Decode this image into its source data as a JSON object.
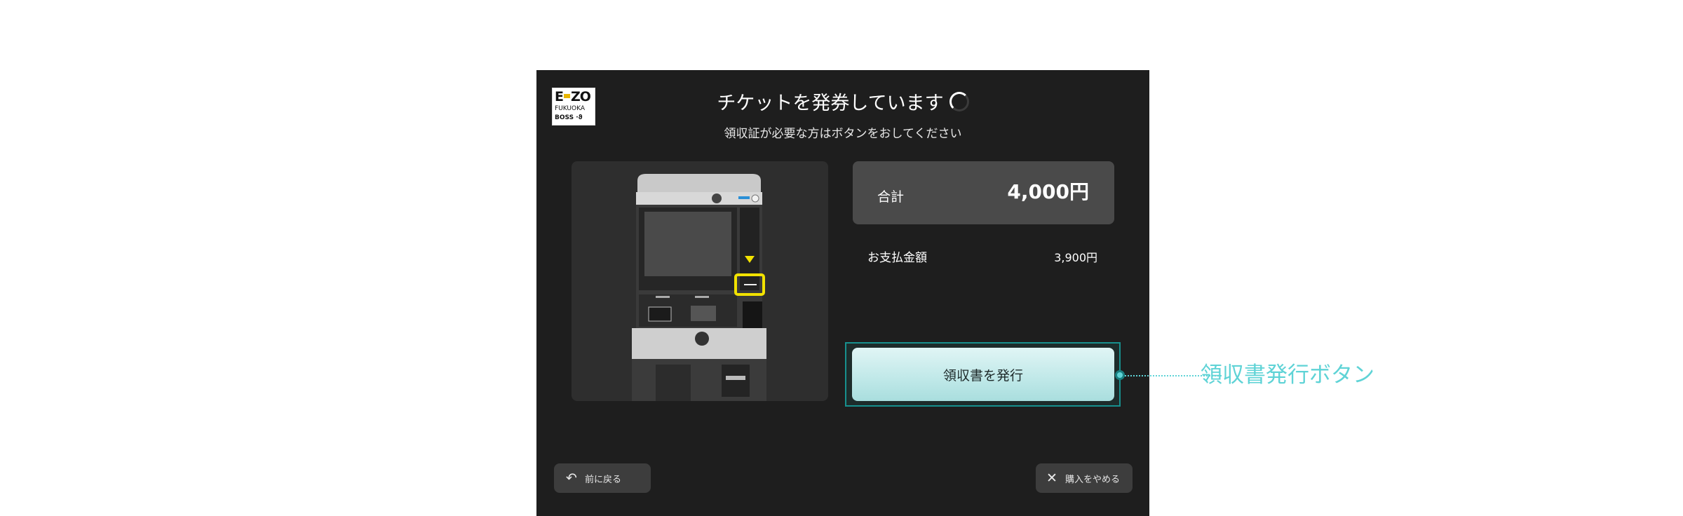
{
  "logo": {
    "line1": "E",
    "line1b": "ZO",
    "line2": "FUKUOKA",
    "line3": "BOSS"
  },
  "header": {
    "title": "チケットを発券しています",
    "subtitle": "領収証が必要な方はボタンをおしてください"
  },
  "summary": {
    "total_label": "合計",
    "total_value": "4,000円",
    "payment_label": "お支払金額",
    "payment_value": "3,900円"
  },
  "actions": {
    "receipt_button": "領収書を発行",
    "back_button": "前に戻る",
    "cancel_button": "購入をやめる"
  },
  "annotation": {
    "label": "領収書発行ボタン"
  },
  "colors": {
    "kiosk_bg": "#1e1e1e",
    "accent_teal": "#5fd3d6",
    "highlight_yellow": "#f2e200"
  },
  "icons": {
    "back": "undo-arrow-icon",
    "cancel": "close-icon",
    "loading": "spinner-icon"
  }
}
